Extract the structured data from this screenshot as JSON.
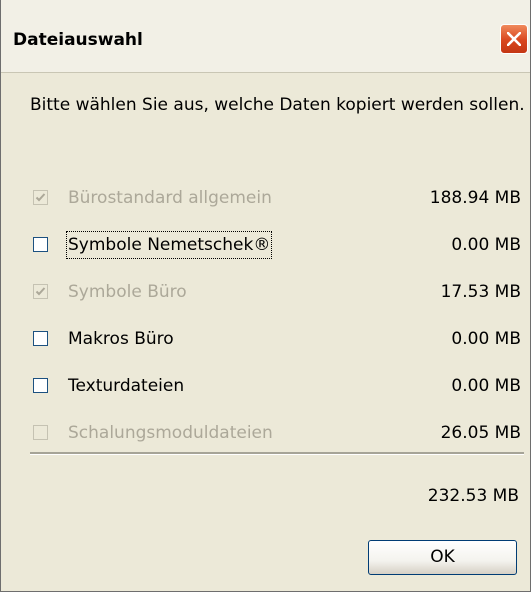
{
  "window": {
    "title": "Dateiauswahl"
  },
  "prompt": "Bitte wählen Sie aus, welche Daten kopiert werden sollen.",
  "items": [
    {
      "label": "Bürostandard allgemein",
      "size": "188.94 MB",
      "checked": true,
      "enabled": false
    },
    {
      "label": "Symbole Nemetschek®",
      "size": "0.00 MB",
      "checked": false,
      "enabled": true,
      "focused": true
    },
    {
      "label": "Symbole Büro",
      "size": "17.53 MB",
      "checked": true,
      "enabled": false
    },
    {
      "label": "Makros Büro",
      "size": "0.00 MB",
      "checked": false,
      "enabled": true
    },
    {
      "label": "Texturdateien",
      "size": "0.00 MB",
      "checked": false,
      "enabled": true
    },
    {
      "label": "Schalungsmoduldateien",
      "size": "26.05 MB",
      "checked": false,
      "enabled": false
    }
  ],
  "total": "232.53 MB",
  "ok_label": "OK",
  "colors": {
    "dialog_bg": "#ECE9D8",
    "disabled_text": "#ACA899",
    "close_red": "#D9461E",
    "checkbox_border": "#1C5180"
  },
  "icons": {
    "close": "close-icon",
    "check": "checkmark-icon"
  }
}
